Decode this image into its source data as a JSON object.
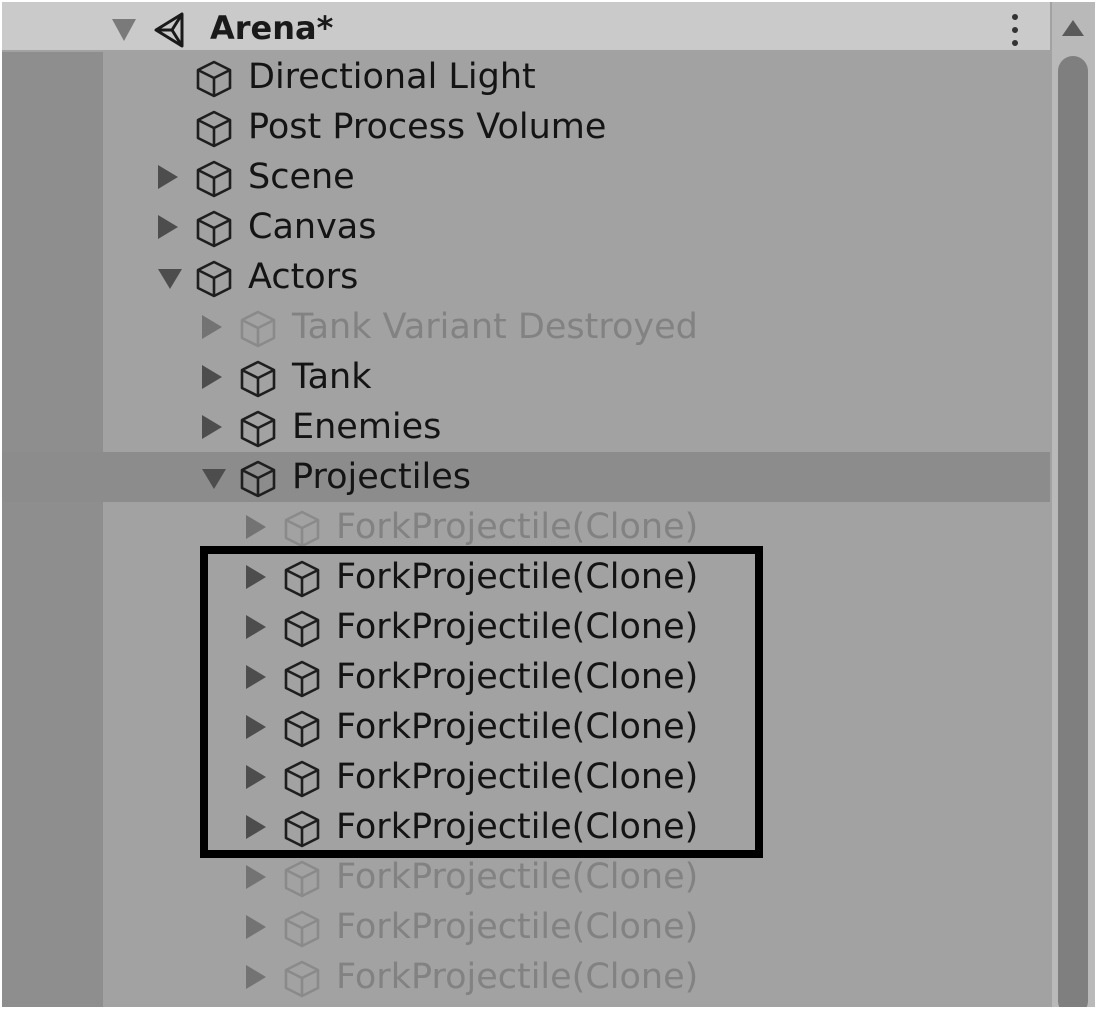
{
  "hierarchy": {
    "scene": {
      "title": "Arena*",
      "expanded": true,
      "icon": "unity-scene-icon"
    },
    "items": [
      {
        "label": "Directional Light",
        "depth": 1,
        "expander": "none",
        "active": true
      },
      {
        "label": "Post Process Volume",
        "depth": 1,
        "expander": "none",
        "active": true
      },
      {
        "label": "Scene",
        "depth": 1,
        "expander": "collapsed",
        "active": true
      },
      {
        "label": "Canvas",
        "depth": 1,
        "expander": "collapsed",
        "active": true
      },
      {
        "label": "Actors",
        "depth": 1,
        "expander": "expanded",
        "active": true
      },
      {
        "label": "Tank Variant Destroyed",
        "depth": 2,
        "expander": "collapsed",
        "active": false
      },
      {
        "label": "Tank",
        "depth": 2,
        "expander": "collapsed",
        "active": true
      },
      {
        "label": "Enemies",
        "depth": 2,
        "expander": "collapsed",
        "active": true
      },
      {
        "label": "Projectiles",
        "depth": 2,
        "expander": "expanded",
        "active": true,
        "selected": true
      },
      {
        "label": "ForkProjectile(Clone)",
        "depth": 3,
        "expander": "collapsed",
        "active": false
      },
      {
        "label": "ForkProjectile(Clone)",
        "depth": 3,
        "expander": "collapsed",
        "active": true
      },
      {
        "label": "ForkProjectile(Clone)",
        "depth": 3,
        "expander": "collapsed",
        "active": true
      },
      {
        "label": "ForkProjectile(Clone)",
        "depth": 3,
        "expander": "collapsed",
        "active": true
      },
      {
        "label": "ForkProjectile(Clone)",
        "depth": 3,
        "expander": "collapsed",
        "active": true
      },
      {
        "label": "ForkProjectile(Clone)",
        "depth": 3,
        "expander": "collapsed",
        "active": true
      },
      {
        "label": "ForkProjectile(Clone)",
        "depth": 3,
        "expander": "collapsed",
        "active": true
      },
      {
        "label": "ForkProjectile(Clone)",
        "depth": 3,
        "expander": "collapsed",
        "active": false
      },
      {
        "label": "ForkProjectile(Clone)",
        "depth": 3,
        "expander": "collapsed",
        "active": false
      },
      {
        "label": "ForkProjectile(Clone)",
        "depth": 3,
        "expander": "collapsed",
        "active": false
      }
    ]
  },
  "icons": {
    "gameobject": "cube-icon",
    "menu": "kebab-menu-icon",
    "scroll_up": "arrow-up-icon"
  },
  "colors": {
    "panel_background": "#a2a2a2",
    "header_background": "#cacaca",
    "selected_row": "#8c8c8c",
    "active_text": "#141414",
    "inactive_text": "#828282",
    "annotation_box": "#000000"
  }
}
